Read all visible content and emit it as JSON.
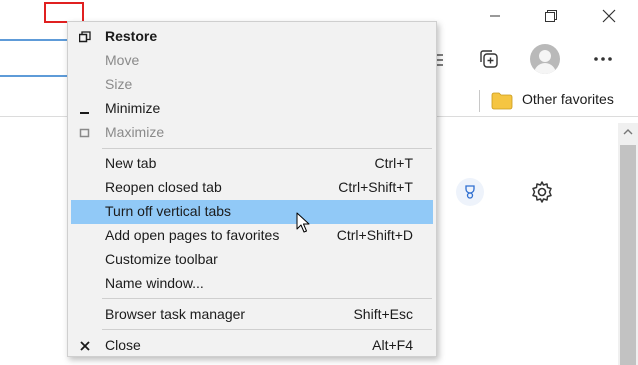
{
  "context_menu": {
    "items": [
      {
        "label": "Restore",
        "shortcut": "",
        "icon": "restore-icon",
        "state": "bold"
      },
      {
        "label": "Move",
        "shortcut": "",
        "icon": "",
        "state": "disabled"
      },
      {
        "label": "Size",
        "shortcut": "",
        "icon": "",
        "state": "disabled"
      },
      {
        "label": "Minimize",
        "shortcut": "",
        "icon": "minimize-icon",
        "state": "normal"
      },
      {
        "label": "Maximize",
        "shortcut": "",
        "icon": "maximize-icon",
        "state": "disabled"
      },
      {
        "label": "New tab",
        "shortcut": "Ctrl+T",
        "icon": "",
        "state": "normal"
      },
      {
        "label": "Reopen closed tab",
        "shortcut": "Ctrl+Shift+T",
        "icon": "",
        "state": "normal"
      },
      {
        "label": "Turn off vertical tabs",
        "shortcut": "",
        "icon": "",
        "state": "highlighted"
      },
      {
        "label": "Add open pages to favorites",
        "shortcut": "Ctrl+Shift+D",
        "icon": "",
        "state": "normal"
      },
      {
        "label": "Customize toolbar",
        "shortcut": "",
        "icon": "",
        "state": "normal"
      },
      {
        "label": "Name window...",
        "shortcut": "",
        "icon": "",
        "state": "normal"
      },
      {
        "label": "Browser task manager",
        "shortcut": "Shift+Esc",
        "icon": "",
        "state": "normal"
      },
      {
        "label": "Close",
        "shortcut": "Alt+F4",
        "icon": "close-icon",
        "state": "normal"
      }
    ],
    "highlight_color": "#91c9f7"
  },
  "favorites_bar": {
    "other_favorites_label": "Other favorites",
    "folder_color": "#f5c542"
  },
  "window_controls": [
    "minimize-icon",
    "maximize-icon",
    "close-icon"
  ],
  "toolbar_icons": [
    "menu-icon",
    "collections-icon",
    "profile-avatar",
    "more-icon"
  ],
  "accent_colors": {
    "focus_border": "#5e9bd8",
    "annotation_box": "#e02020"
  }
}
